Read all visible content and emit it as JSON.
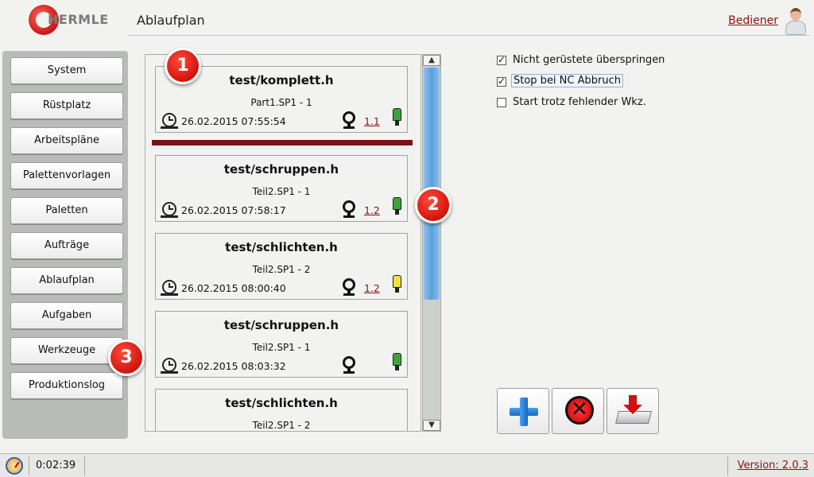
{
  "header": {
    "logo_text": "HERMLE",
    "page_title": "Ablaufplan",
    "user_link": "Bediener"
  },
  "sidebar": {
    "items": [
      {
        "label": "System"
      },
      {
        "label": "Rüstplatz"
      },
      {
        "label": "Arbeitspläne"
      },
      {
        "label": "Palettenvorlagen"
      },
      {
        "label": "Paletten"
      },
      {
        "label": "Aufträge"
      },
      {
        "label": "Ablaufplan"
      },
      {
        "label": "Aufgaben"
      },
      {
        "label": "Werkzeuge"
      },
      {
        "label": "Produktionslog"
      }
    ]
  },
  "jobs": [
    {
      "title": "test/komplett.h",
      "subtitle": "Part1.SP1 - 1",
      "datetime": "26.02.2015 07:55:54",
      "ref": "1.1",
      "marker_color": "#3aa63a"
    },
    {
      "title": "test/schruppen.h",
      "subtitle": "Teil2.SP1 - 1",
      "datetime": "26.02.2015 07:58:17",
      "ref": "1.2",
      "marker_color": "#3aa63a"
    },
    {
      "title": "test/schlichten.h",
      "subtitle": "Teil2.SP1 - 2",
      "datetime": "26.02.2015 08:00:40",
      "ref": "1.2",
      "marker_color": "#f0e23a"
    },
    {
      "title": "test/schruppen.h",
      "subtitle": "Teil2.SP1 - 1",
      "datetime": "26.02.2015 08:03:32",
      "ref": "",
      "marker_color": "#3aa63a"
    },
    {
      "title": "test/schlichten.h",
      "subtitle": "Teil2.SP1 - 2",
      "datetime": "",
      "ref": "",
      "marker_color": ""
    }
  ],
  "options": [
    {
      "label": "Nicht gerüstete überspringen",
      "checked": true
    },
    {
      "label": "Stop bei NC Abbruch",
      "checked": true
    },
    {
      "label": "Start trotz fehlender Wkz.",
      "checked": false
    }
  ],
  "callouts": [
    "1",
    "2",
    "3"
  ],
  "scrollbar": {
    "up": "▲",
    "down": "▼"
  },
  "status": {
    "time": "0:02:39",
    "version": "Version: 2.0.3"
  },
  "colors": {
    "accent_red": "#8b1010",
    "divider": "#7a1212",
    "scroll_thumb": "#5aa0de",
    "callout": "#d2140c"
  }
}
